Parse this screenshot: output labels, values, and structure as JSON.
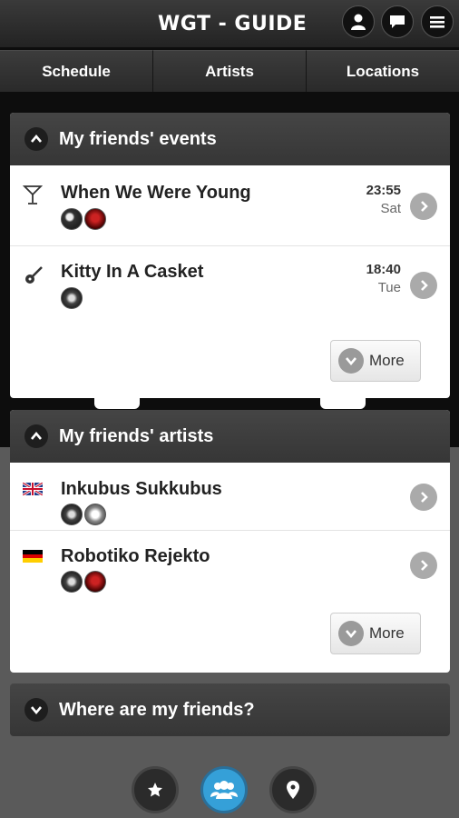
{
  "app": {
    "title": "WGT - GUIDE"
  },
  "top_icons": [
    "user-icon",
    "chat-icon",
    "menu-icon"
  ],
  "nav": {
    "tabs": [
      "Schedule",
      "Artists",
      "Locations"
    ]
  },
  "friends_events": {
    "header": "My friends' events",
    "items": [
      {
        "title": "When We Were Young",
        "time": "23:55",
        "day": "Sat",
        "icon": "cocktail-icon"
      },
      {
        "title": "Kitty In A Casket",
        "time": "18:40",
        "day": "Tue",
        "icon": "guitar-icon"
      }
    ],
    "more_label": "More"
  },
  "friends_artists": {
    "header": "My friends' artists",
    "items": [
      {
        "name": "Inkubus Sukkubus",
        "flag": "uk-flag-icon"
      },
      {
        "name": "Robotiko Rejekto",
        "flag": "germany-flag-icon"
      }
    ],
    "more_label": "More"
  },
  "where_friends": {
    "header": "Where are my friends?"
  },
  "bottom_nav": [
    "star-icon",
    "friends-icon",
    "location-pin-icon"
  ],
  "colors": {
    "accent": "#35a0d8",
    "header": "#3a3a3a",
    "background": "#0d0d0d"
  }
}
